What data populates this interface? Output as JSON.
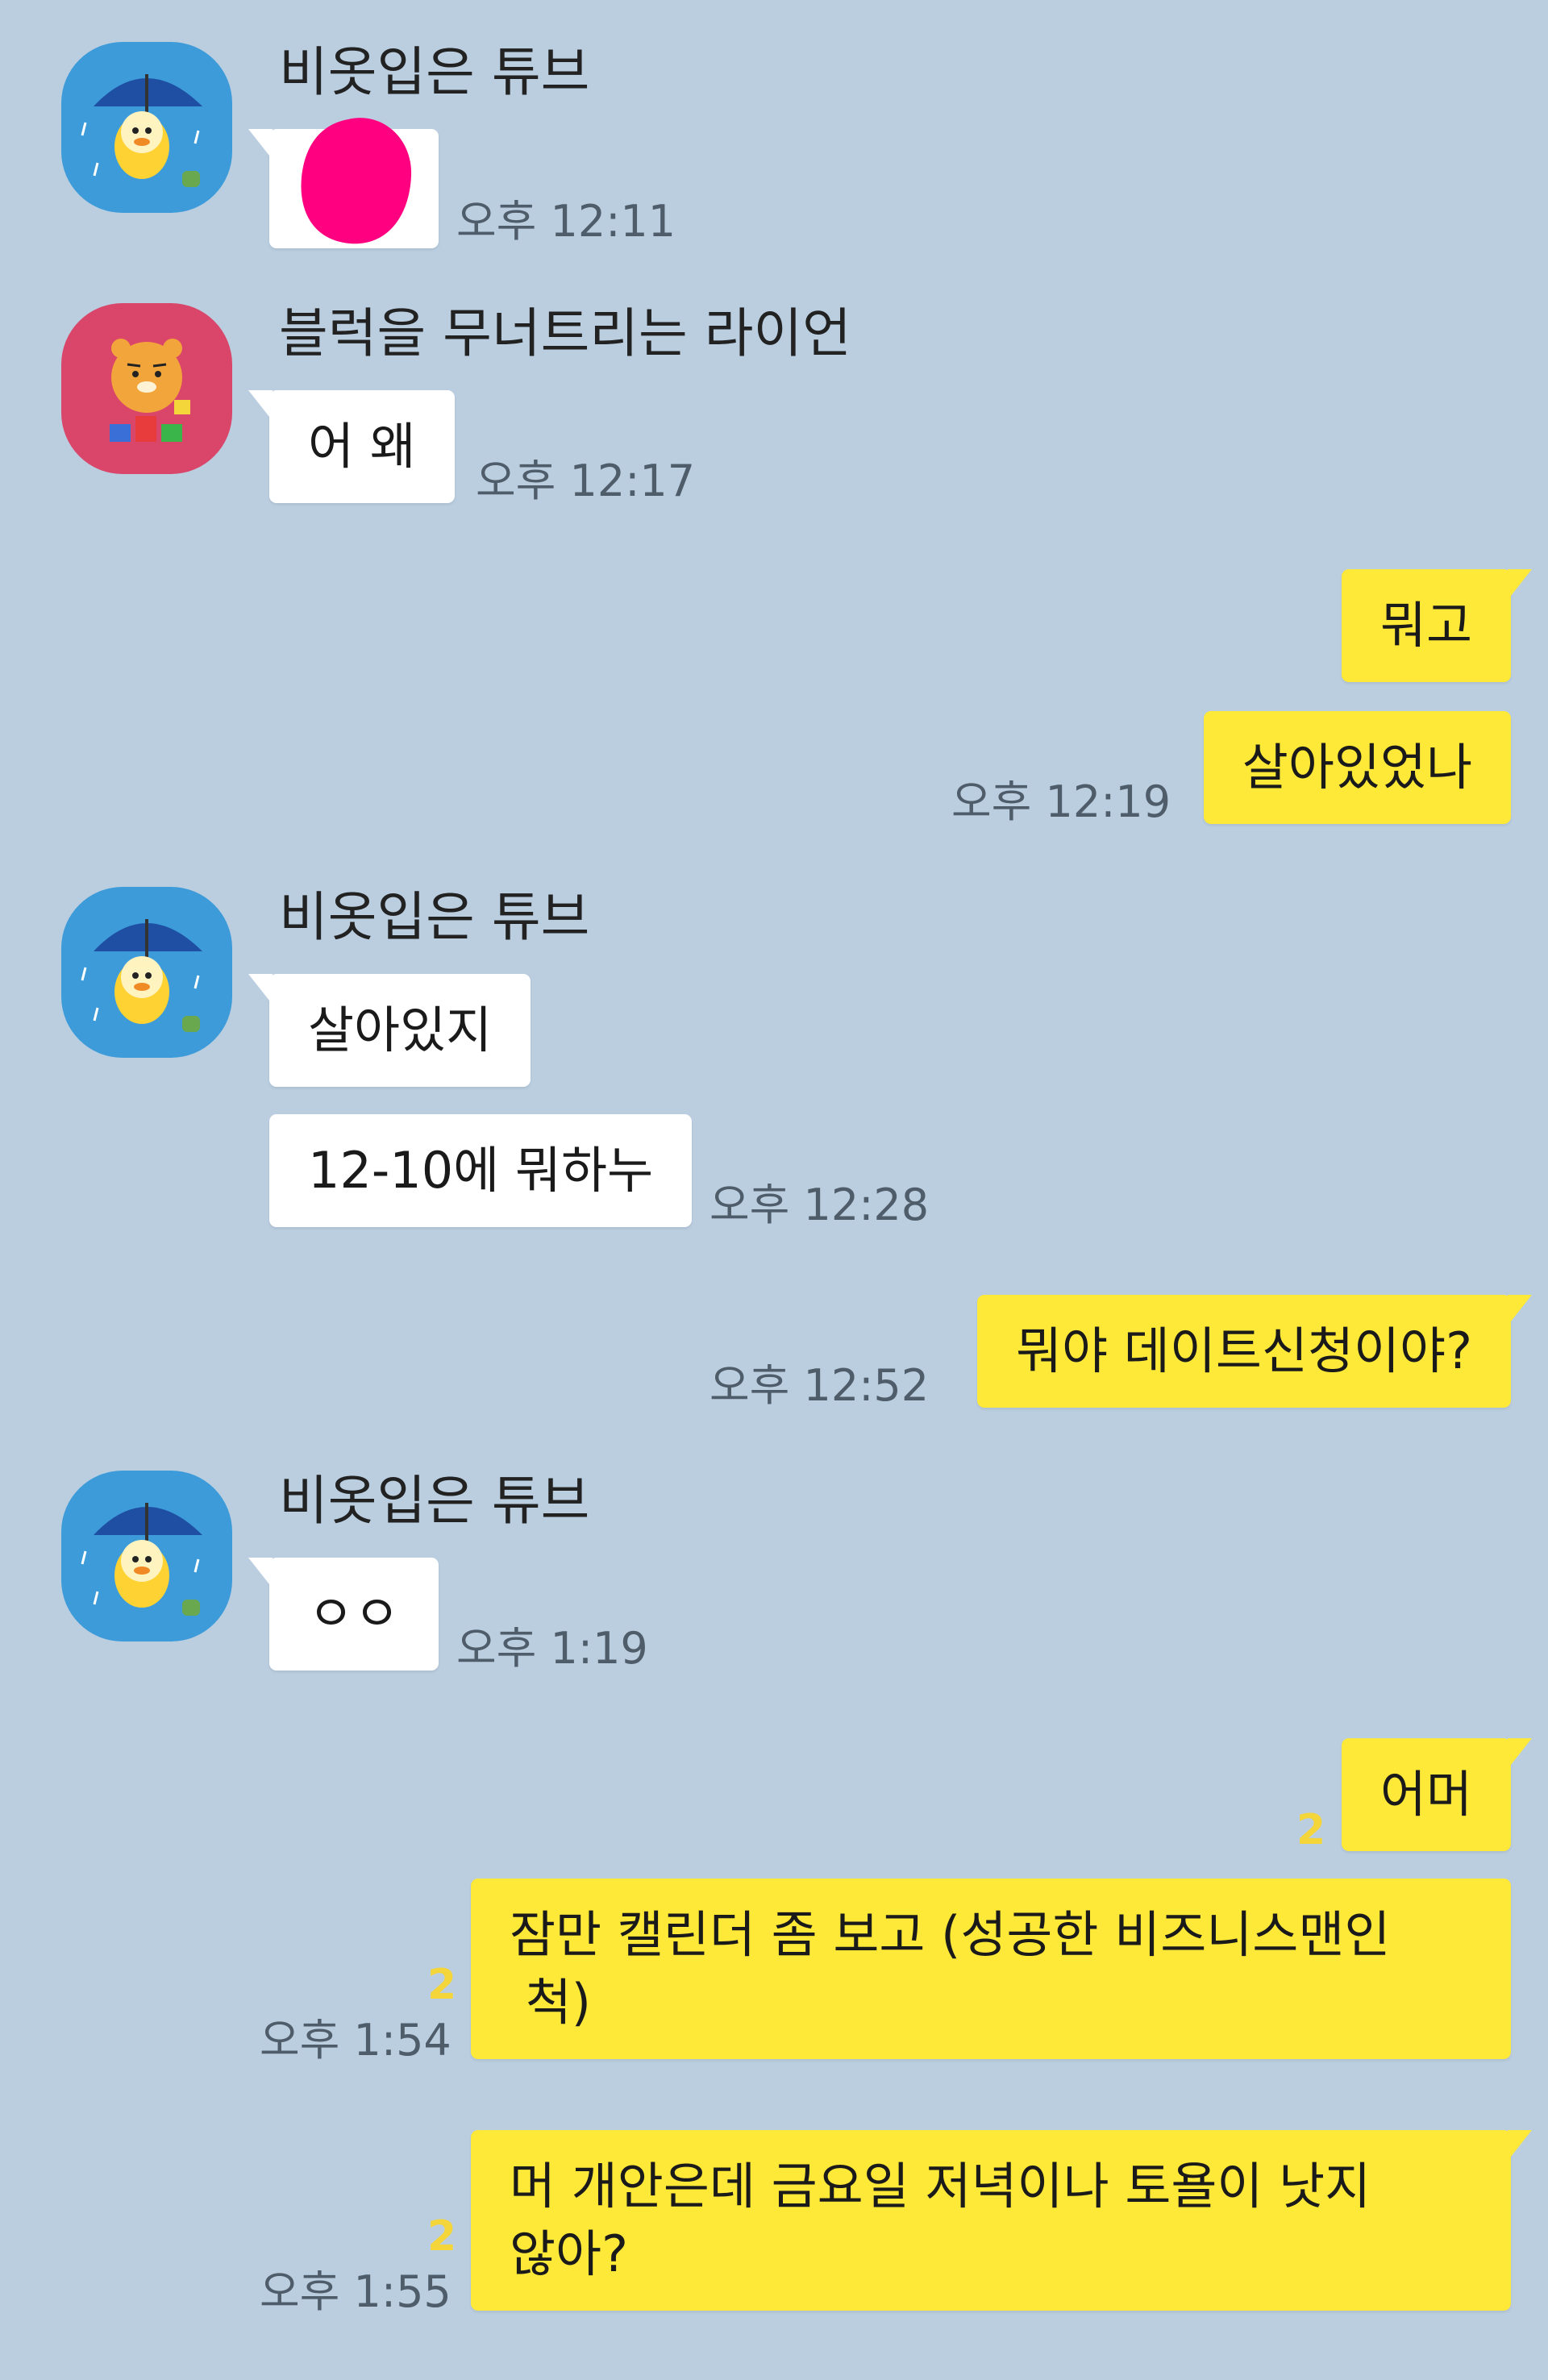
{
  "colors": {
    "background": "#bacee0",
    "incoming_bubble": "#ffffff",
    "outgoing_bubble": "#fee838",
    "unread": "#f5d63a",
    "redaction": "#ff0080"
  },
  "messages": [
    {
      "type": "incoming",
      "sender": "비옷입은 튜브",
      "avatar": "tube-raincoat-avatar-icon",
      "text": "",
      "redacted": true,
      "time": "오후 12:11"
    },
    {
      "type": "incoming",
      "sender": "블럭을 무너트리는 라이언",
      "avatar": "ryan-blocks-avatar-icon",
      "text": "어 왜",
      "time": "오후 12:17"
    },
    {
      "type": "outgoing",
      "text": "뭐고"
    },
    {
      "type": "outgoing",
      "text": "살아있었나",
      "time": "오후 12:19"
    },
    {
      "type": "incoming",
      "sender": "비옷입은 튜브",
      "avatar": "tube-raincoat-avatar-icon",
      "text": "살아있지"
    },
    {
      "type": "incoming",
      "text": "12-10에 뭐하누",
      "time": "오후 12:28"
    },
    {
      "type": "outgoing",
      "text": "뭐야 데이트신청이야?",
      "time": "오후 12:52"
    },
    {
      "type": "incoming",
      "sender": "비옷입은 튜브",
      "avatar": "tube-raincoat-avatar-icon",
      "text": "ㅇㅇ",
      "time": "오후 1:19"
    },
    {
      "type": "outgoing",
      "text": "어머",
      "unread": "2"
    },
    {
      "type": "outgoing",
      "text": "잠만 캘린더 좀 보고 (성공한 비즈니스맨인\n 척)",
      "unread": "2",
      "time": "오후 1:54"
    },
    {
      "type": "outgoing",
      "text": "머 개안은데 금요일 저녁이나 토욜이 낫지\n않아?",
      "unread": "2",
      "time": "오후 1:55"
    }
  ]
}
